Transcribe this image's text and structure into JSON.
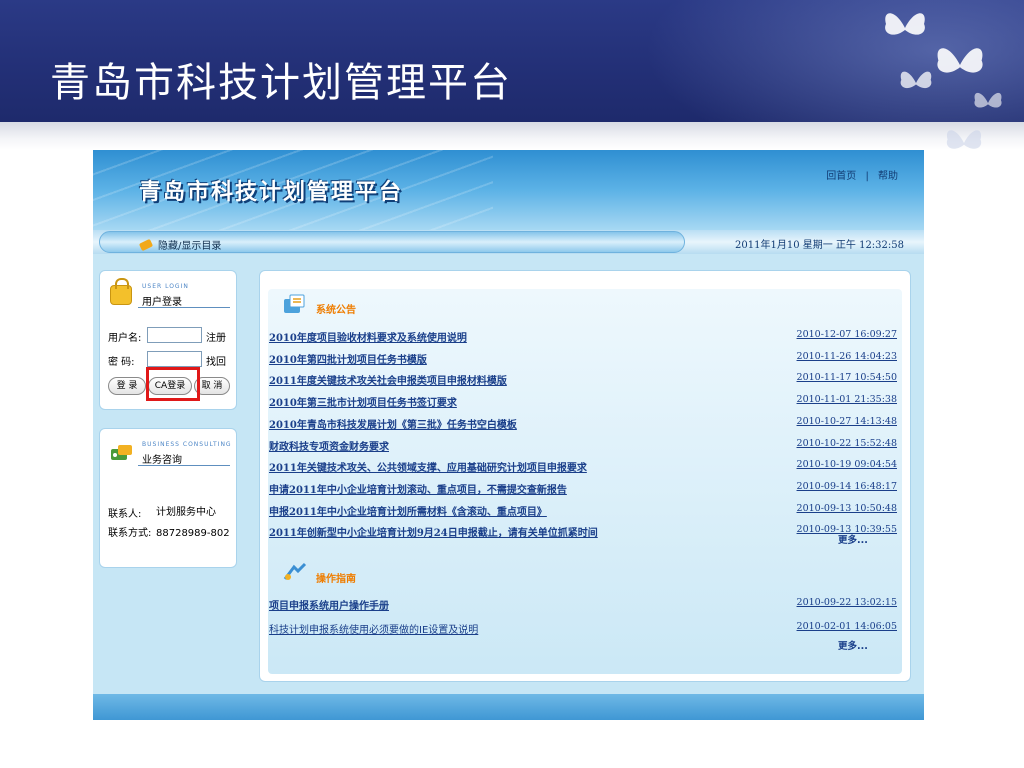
{
  "slide": {
    "title": "青岛市科技计划管理平台"
  },
  "app": {
    "banner_title": "青岛市科技计划管理平台",
    "top_links": {
      "home": "回首页",
      "separator": "|",
      "help": "帮助"
    },
    "nav": {
      "toggle_label": "隐藏/显示目录",
      "datetime": "2011年1月10 星期一 正午 12:32:58"
    }
  },
  "login": {
    "heading_en": "USER LOGIN",
    "heading_cn": "用户登录",
    "username_label": "用户名:",
    "username_value": "",
    "register_link": "注册",
    "password_label": "密  码:",
    "password_value": "",
    "recover_link": "找回",
    "buttons": {
      "login": "登 录",
      "ca_login": "CA登录",
      "cancel": "取 消"
    }
  },
  "consult": {
    "heading_en": "BUSINESS CONSULTING",
    "heading_cn": "业务咨询",
    "contact_label": "联系人:",
    "contact_value": "计划服务中心",
    "phone_label": "联系方式:",
    "phone_value": "88728989-802"
  },
  "announcements": {
    "heading": "系统公告",
    "items": [
      {
        "title": "2010年度项目验收材料要求及系统使用说明",
        "date": "2010-12-07 16:09:27"
      },
      {
        "title": "2010年第四批计划项目任务书模版",
        "date": "2010-11-26 14:04:23"
      },
      {
        "title": "2011年度关键技术攻关社会申报类项目申报材料模版",
        "date": "2010-11-17 10:54:50"
      },
      {
        "title": "2010年第三批市计划项目任务书签订要求",
        "date": "2010-11-01 21:35:38"
      },
      {
        "title": "2010年青岛市科技发展计划《第三批》任务书空白模板",
        "date": "2010-10-27 14:13:48"
      },
      {
        "title": "财政科技专项资金财务要求",
        "date": "2010-10-22 15:52:48"
      },
      {
        "title": "2011年关键技术攻关、公共领域支撑、应用基础研究计划项目申报要求",
        "date": "2010-10-19 09:04:54"
      },
      {
        "title": "申请2011年中小企业培育计划滚动、重点项目，不需提交查新报告",
        "date": "2010-09-14 16:48:17"
      },
      {
        "title": "申报2011年中小企业培育计划所需材料《含滚动、重点项目》",
        "date": "2010-09-13 10:50:48"
      },
      {
        "title": "2011年创新型中小企业培育计划9月24日申报截止，请有关单位抓紧时间",
        "date": "2010-09-13 10:39:55"
      }
    ],
    "more": "更多..."
  },
  "guides": {
    "heading": "操作指南",
    "items": [
      {
        "title": "项目申报系统用户操作手册",
        "date": "2010-09-22 13:02:15"
      },
      {
        "title": "科技计划申报系统使用必须要做的IE设置及说明",
        "date": "2010-02-01 14:06:05"
      }
    ],
    "more": "更多..."
  },
  "colors": {
    "slide_header": "#233077",
    "app_background": "#c6e6f5",
    "link": "#1a3f8a",
    "section_heading": "#ef7d00",
    "highlight_box": "#e01818"
  }
}
